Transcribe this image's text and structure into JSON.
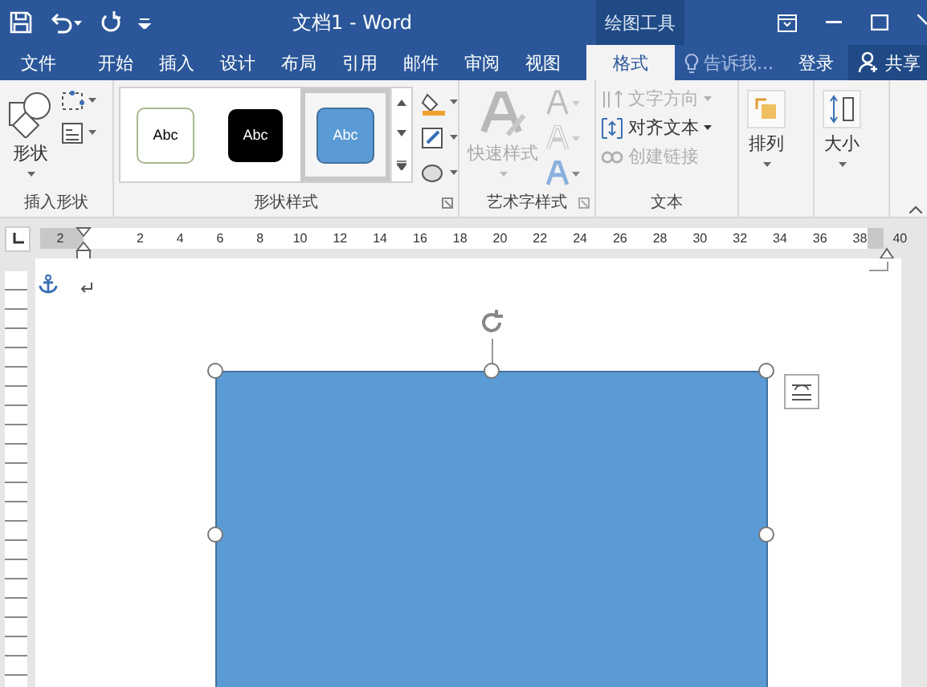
{
  "window": {
    "title": "文档1 - Word",
    "context_group": "绘图工具"
  },
  "tabs": [
    {
      "label": "文件",
      "selected": false
    },
    {
      "label": "开始",
      "selected": false
    },
    {
      "label": "插入",
      "selected": false
    },
    {
      "label": "设计",
      "selected": false
    },
    {
      "label": "布局",
      "selected": false
    },
    {
      "label": "引用",
      "selected": false
    },
    {
      "label": "邮件",
      "selected": false
    },
    {
      "label": "审阅",
      "selected": false
    },
    {
      "label": "视图",
      "selected": false
    },
    {
      "label": "格式",
      "selected": true
    }
  ],
  "tell_me": {
    "placeholder": "告诉我..."
  },
  "sign_in": "登录",
  "share": "共享",
  "insert_shapes": {
    "label": "插入形状",
    "shapes_button": "形状"
  },
  "shape_styles": {
    "label": "形状样式",
    "styles": [
      {
        "label": "Abc",
        "kind": "outline",
        "selected": false
      },
      {
        "label": "Abc",
        "kind": "black",
        "selected": false
      },
      {
        "label": "Abc",
        "kind": "blue",
        "selected": true
      }
    ]
  },
  "wordart_styles": {
    "label": "艺术字样式",
    "quick_styles": {
      "label": "快速样式",
      "disabled": true
    }
  },
  "text": {
    "label": "文本",
    "items": [
      {
        "label": "文字方向",
        "kind": "direction",
        "disabled": true
      },
      {
        "label": "对齐文本",
        "kind": "align",
        "disabled": false
      },
      {
        "label": "创建链接",
        "kind": "link",
        "disabled": true
      }
    ]
  },
  "arrange": {
    "label": "排列"
  },
  "size": {
    "label": "大小"
  },
  "ruler": {
    "ticks": [
      "2",
      "2",
      "4",
      "6",
      "8",
      "10",
      "12",
      "14",
      "16",
      "18",
      "20",
      "22",
      "24",
      "26",
      "28",
      "30",
      "32",
      "34",
      "36",
      "38",
      "40"
    ]
  }
}
